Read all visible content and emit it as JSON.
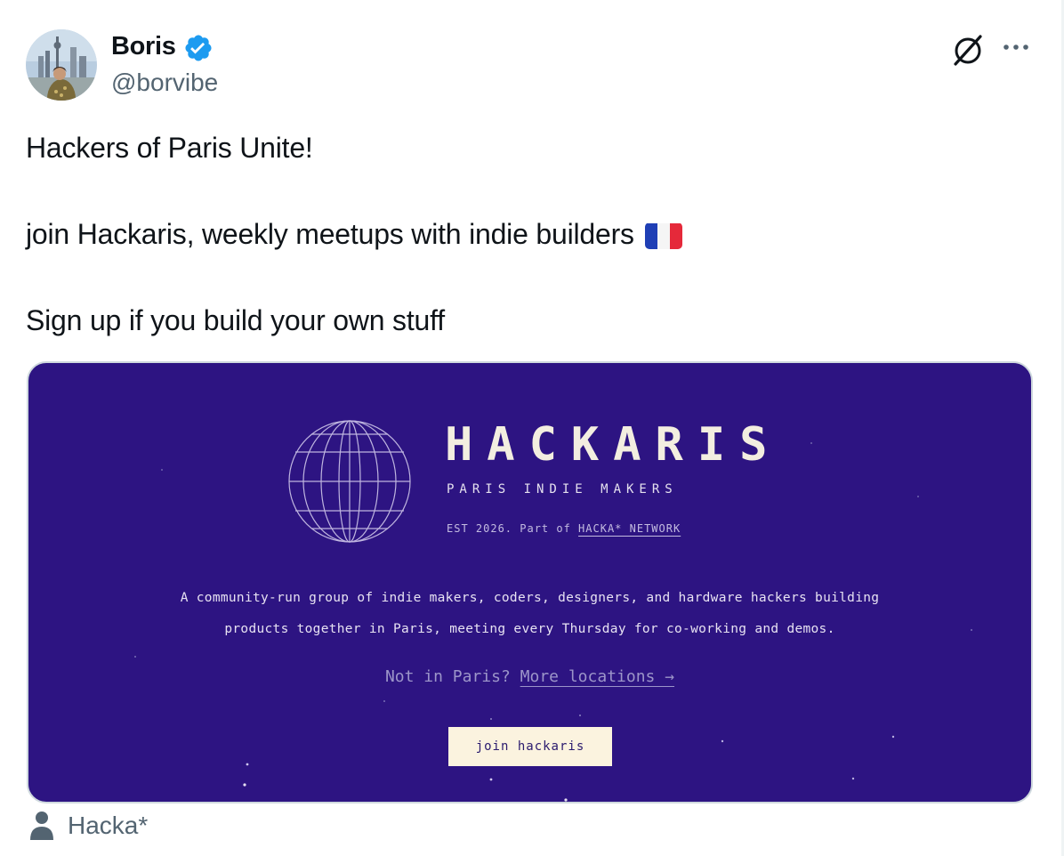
{
  "author": {
    "display_name": "Boris",
    "handle": "@borvibe",
    "verified": true,
    "avatar_icon": "avatar-photo"
  },
  "header_actions": {
    "grok_icon": "grok-icon",
    "more_icon": "more-icon"
  },
  "tweet": {
    "line1": "Hackers of Paris Unite!",
    "line2": "join Hackaris, weekly meetups with indie builders",
    "line2_emoji": "french-flag",
    "line3": "Sign up if you build your own stuff"
  },
  "card": {
    "title": "HACKARIS",
    "subtitle": "PARIS INDIE MAKERS",
    "est_prefix": "EST 2026. Part of ",
    "network": "HACKA* NETWORK",
    "description_line1": "A community-run group of indie makers, coders, designers, and hardware hackers building",
    "description_line2": "products together in Paris, meeting every Thursday for co-working and demos.",
    "locations_prefix": "Not in Paris? ",
    "locations_link": "More locations →",
    "join_button": "join hackaris",
    "background_color": "#2d1482",
    "button_color": "#fbf3df"
  },
  "footer": {
    "icon": "person-icon",
    "label": "Hacka*"
  },
  "colors": {
    "verified_blue": "#1d9bf0",
    "secondary_text": "#536471"
  }
}
